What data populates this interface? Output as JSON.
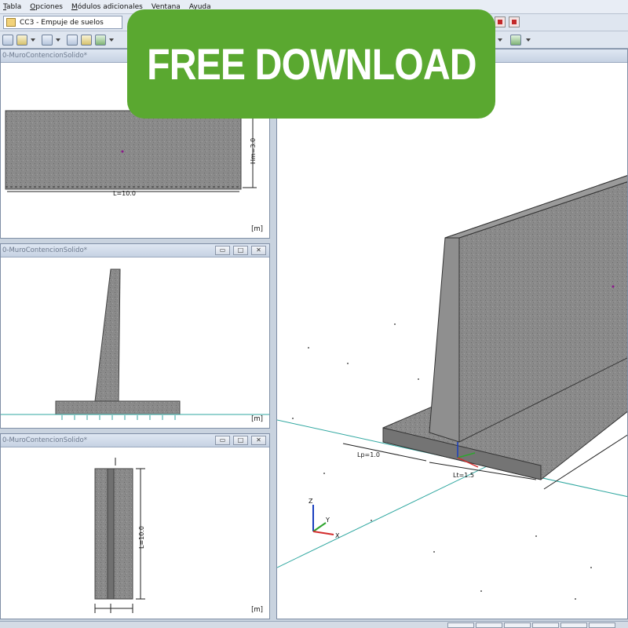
{
  "menu": {
    "items": [
      "Tabla",
      "Opciones",
      "Módulos adicionales",
      "Ventana",
      "Ayuda"
    ]
  },
  "project": {
    "selected": "CC3 - Empuje de suelos"
  },
  "banner": {
    "text": "FREE DOWNLOAD",
    "color": "#5aa830"
  },
  "panes": {
    "front_view": {
      "title": "0-MuroContencionSolido*",
      "dim_length": "L=10.0",
      "dim_height": "Hm=3.0",
      "unit": "[m]"
    },
    "section_view": {
      "title": "0-MuroContencionSolido*",
      "unit": "[m]"
    },
    "top_view": {
      "title": "0-MuroContencionSolido*",
      "dim_length": "L=10.0",
      "unit": "[m]"
    },
    "iso_view": {
      "dim_lp": "Lp=1.0",
      "dim_lt": "Lt=1.5",
      "axis_x": "X",
      "axis_y": "Y",
      "axis_z": "Z"
    }
  },
  "window_buttons": {
    "minimize": "▭",
    "maximize": "□",
    "close": "✕"
  },
  "colors": {
    "concrete": "#8a8a8a",
    "support_line": "#2fa7a0",
    "x_axis": "#d32b2b",
    "y_axis": "#2ea52e",
    "z_axis": "#1a3fbf"
  }
}
